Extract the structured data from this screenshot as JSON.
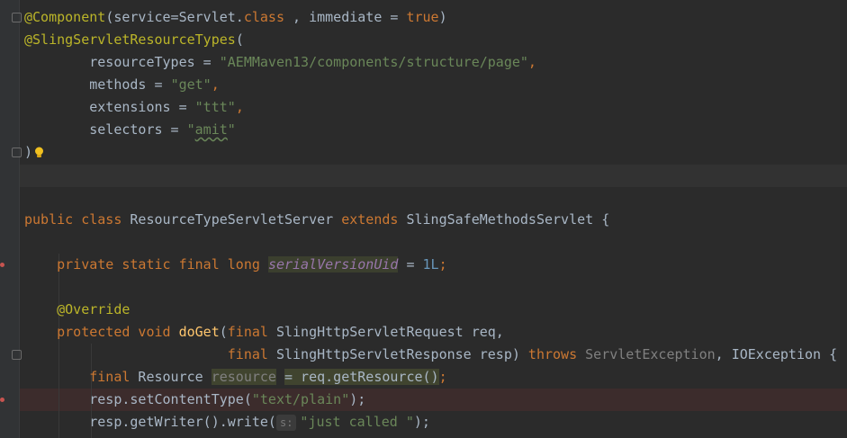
{
  "code": {
    "l01": {
      "ann": "@Component",
      "p1": "(service=Servlet.",
      "kw1": "class",
      "p2": " , immediate = ",
      "kw2": "true",
      "p3": ")"
    },
    "l02": {
      "ann": "@SlingServletResourceTypes",
      "p1": "("
    },
    "l03": {
      "p1": "        resourceTypes = ",
      "str": "\"AEMMaven13/components/structure/page\"",
      "p2": ","
    },
    "l04": {
      "p1": "        methods = ",
      "str": "\"get\"",
      "p2": ","
    },
    "l05": {
      "p1": "        extensions = ",
      "str": "\"ttt\"",
      "p2": ","
    },
    "l06": {
      "p1": "        selectors = ",
      "q1": "\"",
      "str": "amit",
      "q2": "\""
    },
    "l07": {
      "p1": ")"
    },
    "l08": {
      "kw1": "public class",
      "p1": " ResourceTypeServletServer ",
      "kw2": "extends",
      "p2": " SlingSafeMethodsServlet {"
    },
    "l09": {
      "indent": "    ",
      "kw": "private static final long",
      "sp": " ",
      "field": "serialVersionUid",
      "p1": " = ",
      "num": "1L",
      "p2": ";"
    },
    "l10": {
      "indent": "    ",
      "ann": "@Override"
    },
    "l11": {
      "indent": "    ",
      "kw1": "protected void",
      "sp": " ",
      "method": "doGet",
      "p1": "(",
      "kw2": "final",
      "p2": " SlingHttpServletRequest req,"
    },
    "l12": {
      "indent": "                         ",
      "kw1": "final",
      "p1": " SlingHttpServletResponse resp) ",
      "kw2": "throws",
      "sp": " ",
      "muted": "ServletException",
      "p2": ", IOException {"
    },
    "l13": {
      "indent": "        ",
      "kw": "final",
      "p1": " Resource ",
      "var": "resource",
      "sp": " ",
      "expr": "= req.getResource()",
      "p2": ";"
    },
    "l14": {
      "indent": "        ",
      "p1": "resp.setContentType(",
      "str": "\"text/plain\"",
      "p2": ");"
    },
    "l15": {
      "indent": "        ",
      "p1": "resp.getWriter().write(",
      "hint": "s:",
      "str": "\"just called \"",
      "p2": ");"
    }
  },
  "colors": {
    "background": "#2b2b2b",
    "gutter": "#313335",
    "caret_line": "#323232",
    "error_line": "#3c2c2c",
    "keyword": "#cc7832",
    "annotation": "#bbb529",
    "string": "#6a8759",
    "number": "#6897bb",
    "field": "#9876aa",
    "method": "#ffc66d",
    "default_text": "#a9b7c6",
    "breakpoint": "#c75450",
    "intention_bulb": "#f0c020"
  },
  "icons": [
    "fold-marker-icon",
    "breakpoint-icon",
    "intention-bulb-icon"
  ]
}
